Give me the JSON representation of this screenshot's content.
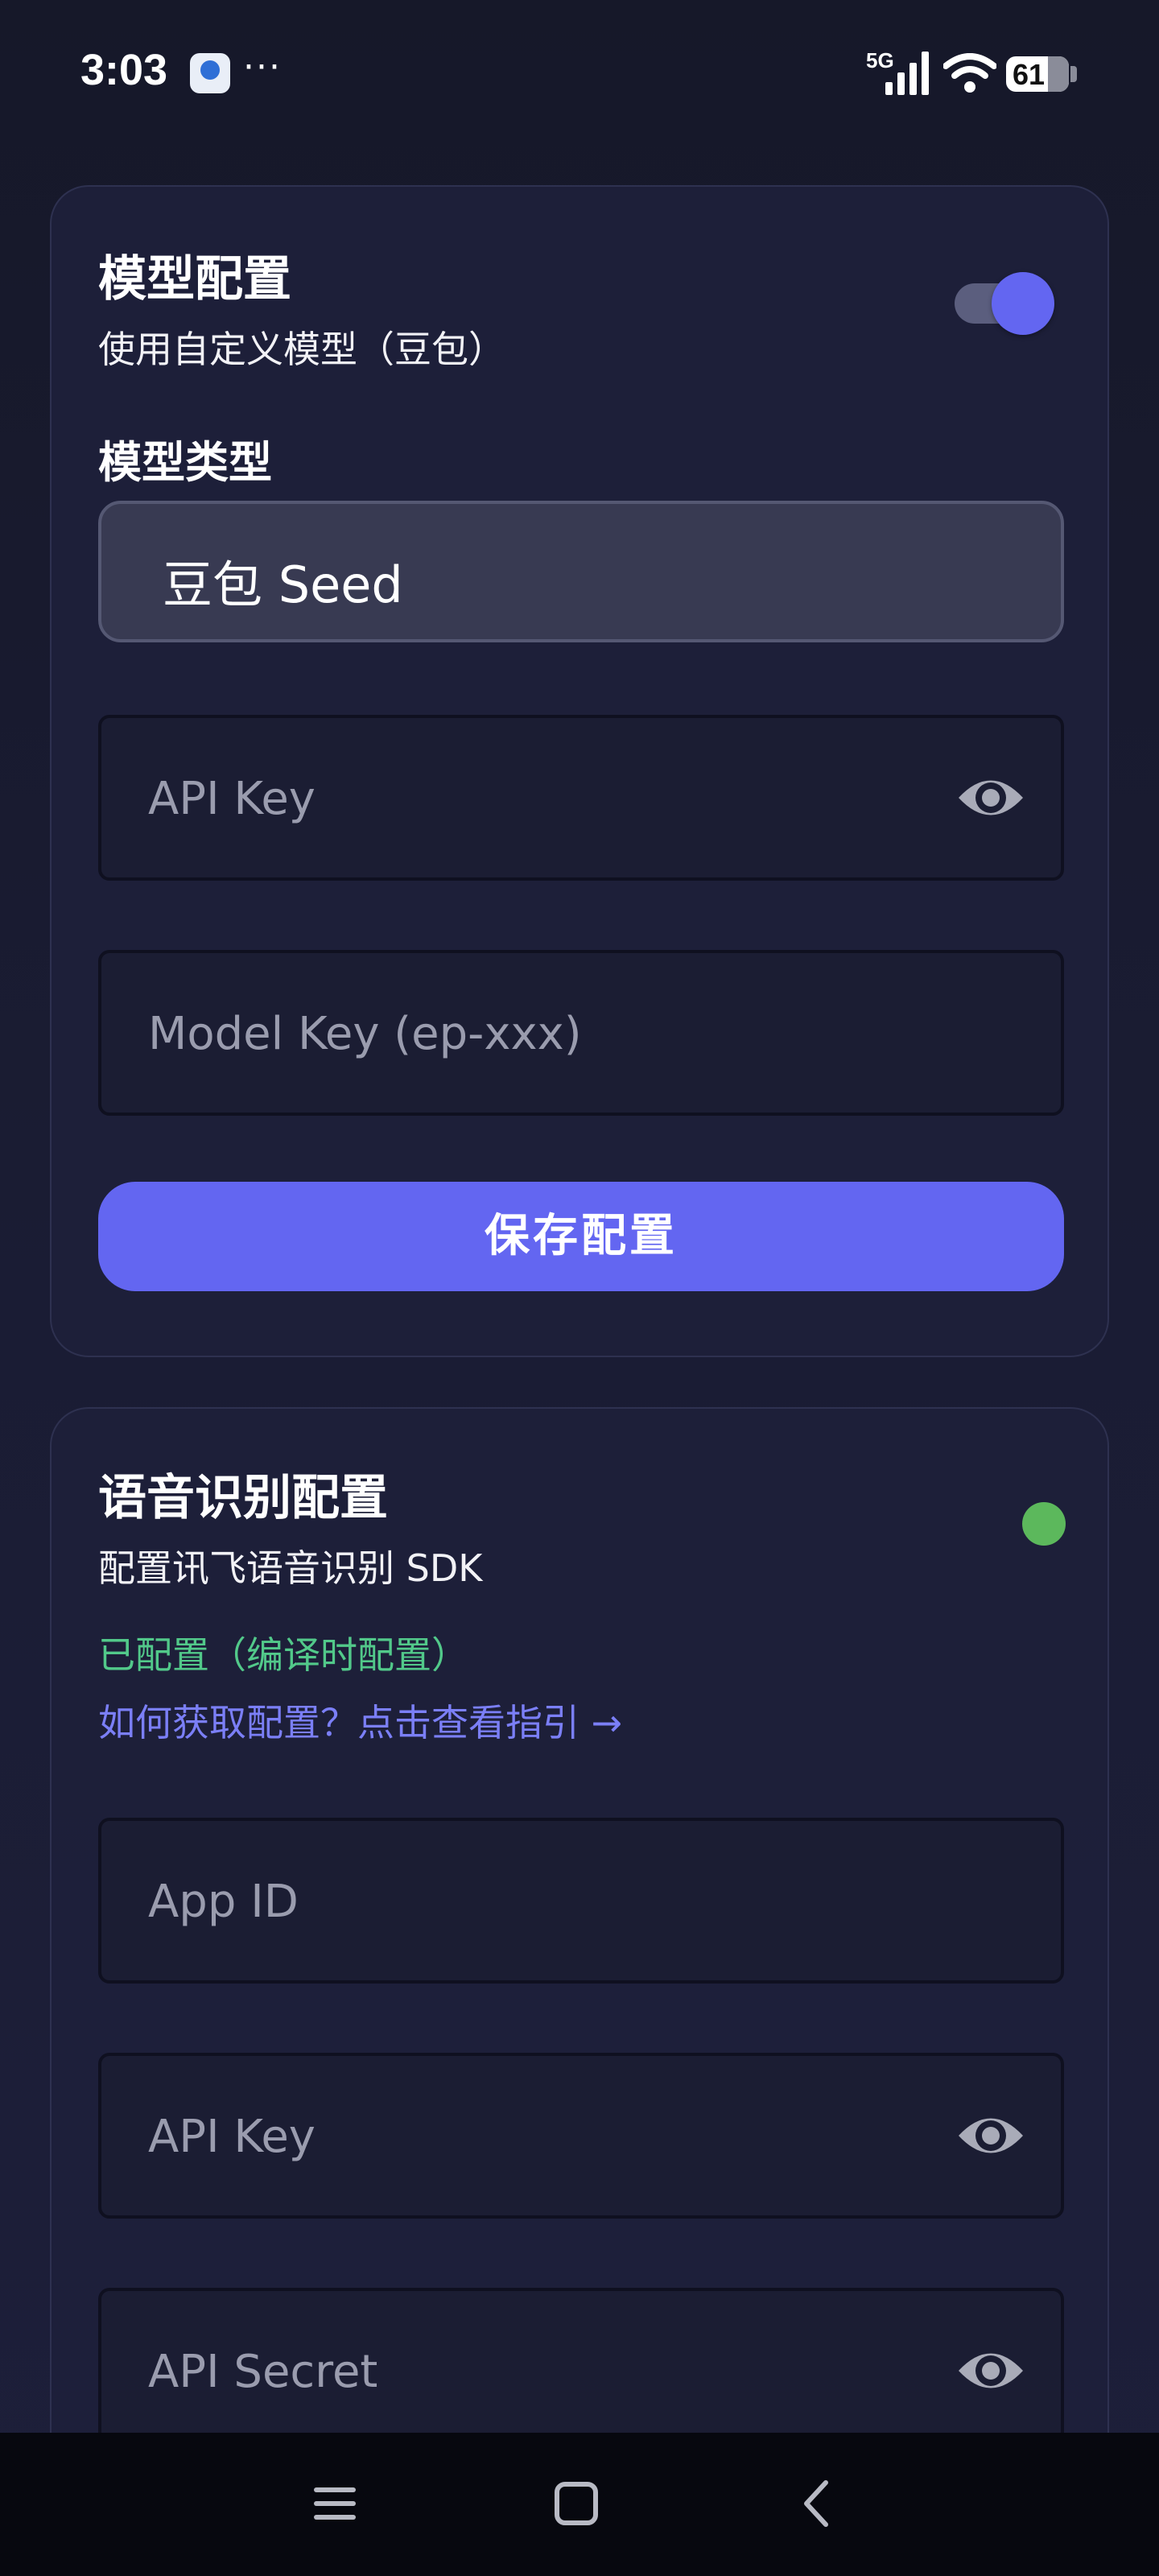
{
  "status_bar": {
    "time": "3:03",
    "more": "···",
    "network": "5G",
    "battery": "61"
  },
  "model_config": {
    "title": "模型配置",
    "subtitle": "使用自定义模型（豆包）",
    "toggle_on": true,
    "model_type_label": "模型类型",
    "model_type_value": "豆包 Seed",
    "api_key_placeholder": "API Key",
    "model_key_placeholder": "Model Key (ep-xxx)",
    "save_label": "保存配置"
  },
  "speech_config": {
    "title": "语音识别配置",
    "subtitle": "配置讯飞语音识别 SDK",
    "status_text": "已配置（编译时配置）",
    "guide_link": "如何获取配置？点击查看指引 →",
    "app_id_placeholder": "App ID",
    "api_key_placeholder": "API Key",
    "api_secret_placeholder": "API Secret"
  },
  "colors": {
    "accent": "#6366f1",
    "success_text": "#52c98a",
    "status_dot": "#5cb85c",
    "link": "#7b7ff7"
  },
  "icons": [
    "app-icon",
    "signal-icon",
    "wifi-icon",
    "battery-icon",
    "eye-icon",
    "menu-icon",
    "home-icon",
    "back-icon"
  ]
}
